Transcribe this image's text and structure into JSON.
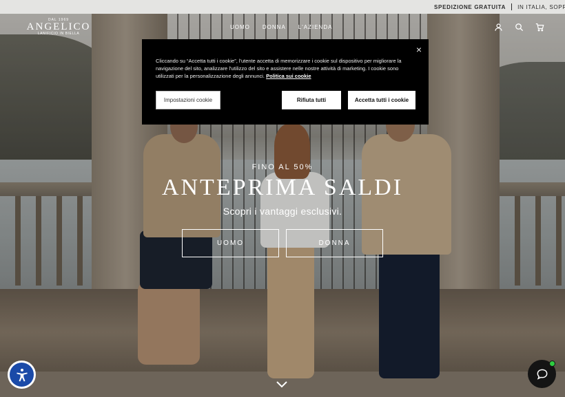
{
  "announcement": {
    "shipping_label": "SPEDIZIONE GRATUITA",
    "shipping_detail": "IN ITALIA, SOPRA A"
  },
  "header": {
    "logo": {
      "est": "DAL 1969",
      "name": "ANGELICO",
      "sub": "LANIFICIO IN BIELLA"
    },
    "nav": [
      {
        "label": "UOMO"
      },
      {
        "label": "DONNA"
      },
      {
        "label": "L'AZIENDA"
      }
    ],
    "icons": [
      "account-icon",
      "search-icon",
      "cart-icon"
    ]
  },
  "hero": {
    "kicker": "FINO AL 50%",
    "headline": "ANTEPRIMA SALDI",
    "subheadline": "Scopri i vantaggi esclusivi.",
    "cta_uomo": "UOMO",
    "cta_donna": "DONNA"
  },
  "cookie_banner": {
    "text": "Cliccando su “Accetta tutti i cookie”, l'utente accetta di memorizzare i cookie sul dispositivo per migliorare la navigazione del sito, analizzare l'utilizzo del sito e assistere nelle nostre attività di marketing. I cookie sono utilizzati per la personalizzazione degli annunci.",
    "policy_link": "Politica sui cookie",
    "settings_button": "Impostazioni cookie",
    "reject_button": "Rifiuta tutti",
    "accept_button": "Accetta tutti i cookie",
    "close_label": "×"
  },
  "colors": {
    "cookie_bg": "#000000",
    "accessibility_blue": "#1a4aa8",
    "chat_bg": "#141414",
    "online_dot": "#2ecc40"
  }
}
